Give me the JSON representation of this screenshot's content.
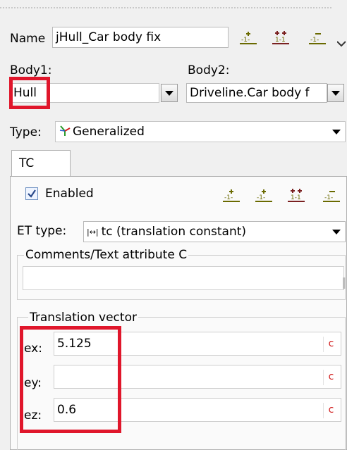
{
  "header": {
    "name_label": "Name",
    "name_value": "jHull_Car body fix"
  },
  "bodies": {
    "body1_label": "Body1:",
    "body1_value": "Hull",
    "body2_label": "Body2:",
    "body2_value": "Driveline.Car body f"
  },
  "type": {
    "label": "Type:",
    "value": "Generalized",
    "icon": "generalized-joint-icon"
  },
  "tabs": [
    {
      "label": "TC"
    }
  ],
  "tc": {
    "enabled_label": "Enabled",
    "enabled_checked": true,
    "et_type_label": "ET type:",
    "et_type_value": "tc (translation constant)",
    "comments_label": "Comments/Text attribute C",
    "comments_value": ""
  },
  "translation": {
    "group_label": "Translation vector",
    "ex_label": "ex:",
    "ex_value": "5.125",
    "ey_label": "ey:",
    "ey_value": "",
    "ez_label": "ez:",
    "ez_value": "0.6",
    "c_label": "c"
  },
  "colors": {
    "highlight": "#e0162b",
    "c_button": "#d11b1b",
    "checkbox": "#2a6fd1"
  }
}
